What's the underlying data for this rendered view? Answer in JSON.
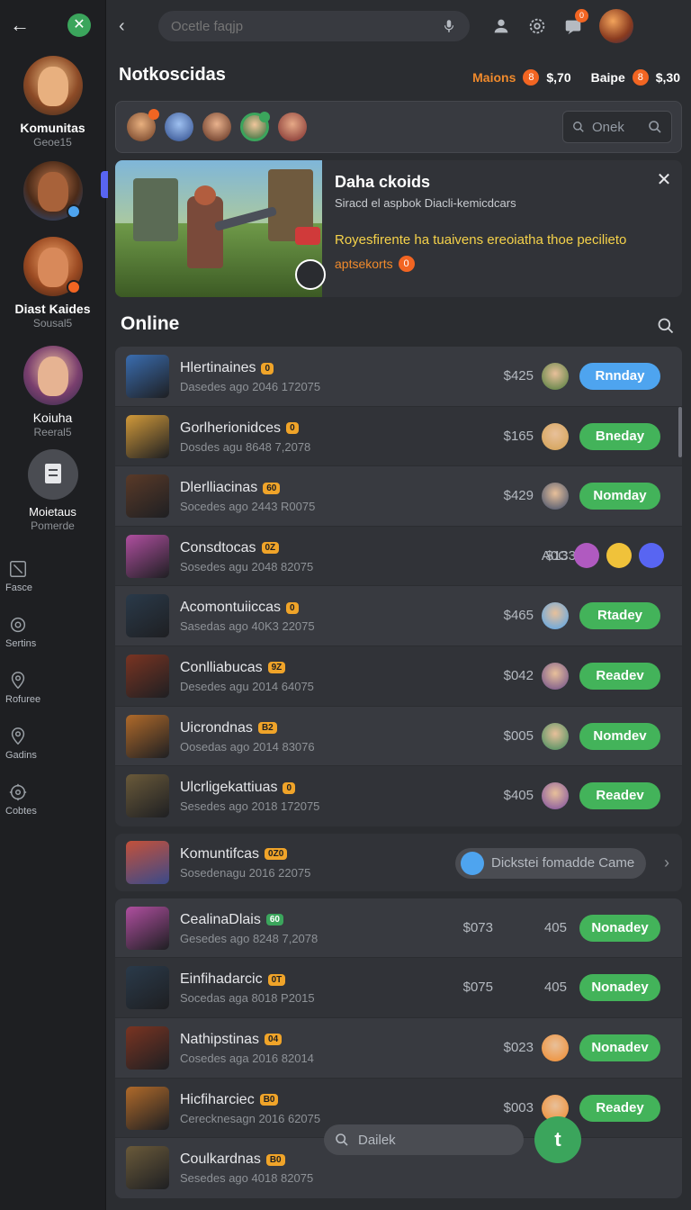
{
  "nav": {
    "back_glyph": "←",
    "close_glyph": "✕"
  },
  "rail": {
    "profiles": [
      {
        "name": "Komunitas",
        "sub": "Geoe15"
      },
      {
        "name": "",
        "sub": ""
      },
      {
        "name": "Diast Kaides",
        "sub": "Sousal5"
      },
      {
        "name": "Koiuha",
        "sub": "Reeral5"
      },
      {
        "name": "Moietaus",
        "sub": "Pomerde"
      }
    ],
    "items": [
      {
        "label": "Fasce",
        "icon": "edit-icon"
      },
      {
        "label": "Sertins",
        "icon": "settings-icon"
      },
      {
        "label": "Rofuree",
        "icon": "location-icon"
      },
      {
        "label": "Gadins",
        "icon": "location-icon"
      },
      {
        "label": "Cobtes",
        "icon": "gear-icon"
      }
    ]
  },
  "topbar": {
    "search_placeholder": "Ocetle faqjp"
  },
  "page": {
    "title": "Notkoscidas"
  },
  "stats": {
    "label1": "Maions",
    "badge1": "8",
    "value1": "$,70",
    "label2": "Baipe",
    "badge2": "8",
    "value2": "$,30"
  },
  "friends": {
    "search_placeholder": "Onek"
  },
  "promo": {
    "title": "Daha ckoids",
    "subtitle": "Siracd el aspbok Diacli-kemicdcars",
    "highlight": "Royesfirente ha tuaivens ereoiatha thoe pecilieto",
    "link": "aptsekorts",
    "link_badge": "0"
  },
  "section": {
    "title": "Online"
  },
  "rows1": [
    {
      "name": "Hlertinaines",
      "tag": "0",
      "meta": "Dasedes ago 2046 172075",
      "price": "$425",
      "button": "Rnnday",
      "btn_style": "blue"
    },
    {
      "name": "Gorlherionidces",
      "tag": "0",
      "meta": "Dosdes agu 8648 7,2078",
      "price": "$165",
      "button": "Bneday",
      "btn_style": "green"
    },
    {
      "name": "Dlerlliacinas",
      "tag": "60",
      "meta": "Socedes ago 2443 R0075",
      "price": "$429",
      "button": "Nomday",
      "btn_style": "green"
    },
    {
      "name": "Consdtocas",
      "tag": "0Z",
      "meta": "Sosedes agu 2048 82075",
      "price": "$133",
      "extra": "A0C",
      "button": "",
      "btn_style": "circles"
    },
    {
      "name": "Acomontuiiccas",
      "tag": "0",
      "meta": "Sasedas ago 40K3 22075",
      "price": "$465",
      "button": "Rtadey",
      "btn_style": "green"
    },
    {
      "name": "Conlliabucas",
      "tag": "9Z",
      "meta": "Desedes agu 2014 64075",
      "price": "$042",
      "button": "Readev",
      "btn_style": "green"
    },
    {
      "name": "Uicrondnas",
      "tag": "B2",
      "meta": "Oosedas ago 2014 83076",
      "price": "$005",
      "button": "Nomdev",
      "btn_style": "green"
    },
    {
      "name": "Ulcrligekattiuas",
      "tag": "0",
      "meta": "Sesedes ago 2018 172075",
      "price": "$405",
      "button": "Readev",
      "btn_style": "green"
    }
  ],
  "invite_row": {
    "name": "Komuntifcas",
    "tag": "0Z0",
    "meta": "Sosedenagu 2016 22075",
    "pill": "Dickstei fomadde Came",
    "chevron": "›"
  },
  "rows2": [
    {
      "name": "CealinaDlais",
      "tag": "60",
      "tag_color": "green",
      "meta": "Gesedes ago 8248 7,2078",
      "price": "$073",
      "extra": "405",
      "button": "Nonadey"
    },
    {
      "name": "Einfihadarcic",
      "tag": "0T",
      "meta": "Socedas aga 8018 P2015",
      "price": "$075",
      "extra": "405",
      "button": "Nonadey"
    },
    {
      "name": "Nathipstinas",
      "tag": "04",
      "meta": "Cosedes aga 2016 82014",
      "price": "$023",
      "button": "Nonadev"
    },
    {
      "name": "Hicfiharciec",
      "tag": "B0",
      "meta": "Cerecknesagn 2016 62075",
      "price": "$003",
      "button": "Readey"
    },
    {
      "name": "Coulkardnas",
      "tag": "B0",
      "meta": "Sesedes ago 4018 82075",
      "price": "",
      "button": ""
    }
  ],
  "bottom": {
    "search_placeholder": "Dailek",
    "fab_glyph": "t"
  },
  "colors": {
    "accent_green": "#43b35a",
    "accent_blue": "#4ea4ef",
    "badge_orange": "#f26522",
    "highlight_yellow": "#f5d24a"
  }
}
